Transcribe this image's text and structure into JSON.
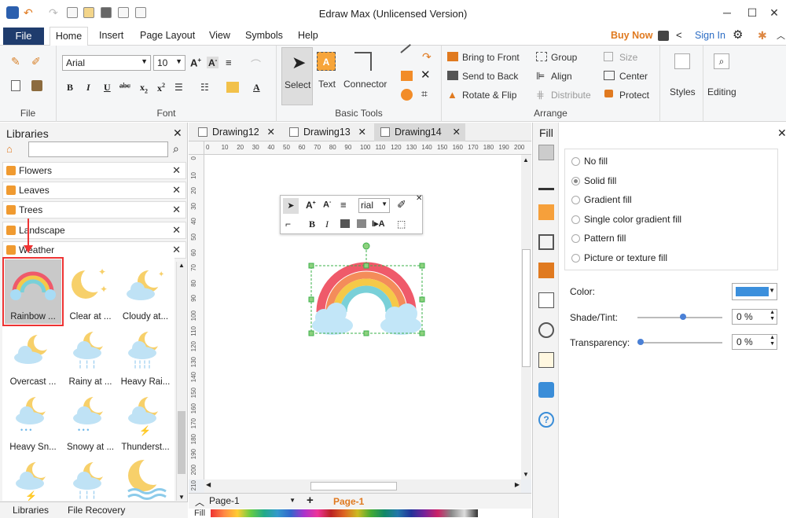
{
  "app": {
    "title": "Edraw Max (Unlicensed Version)"
  },
  "window_controls": {
    "minimize": "─",
    "maximize": "☐",
    "close": "✕"
  },
  "tabs": {
    "file": "File",
    "home": "Home",
    "insert": "Insert",
    "page_layout": "Page Layout",
    "view": "View",
    "symbols": "Symbols",
    "help": "Help"
  },
  "top_right": {
    "buy_now": "Buy Now",
    "sign_in": "Sign In"
  },
  "ribbon": {
    "file_group": "File",
    "font_group": "Font",
    "font_name": "Arial",
    "font_size": "10",
    "basic_tools": {
      "label": "Basic Tools",
      "select": "Select",
      "text": "Text",
      "connector": "Connector"
    },
    "arrange": {
      "label": "Arrange",
      "bring_to_front": "Bring to Front",
      "send_to_back": "Send to Back",
      "rotate_flip": "Rotate & Flip",
      "group": "Group",
      "align": "Align",
      "distribute": "Distribute",
      "size": "Size",
      "center": "Center",
      "protect": "Protect"
    },
    "styles": "Styles",
    "editing": "Editing"
  },
  "libraries": {
    "title": "Libraries",
    "categories": [
      "Flowers",
      "Leaves",
      "Trees",
      "Landscape",
      "Weather"
    ],
    "shapes": [
      "Rainbow ...",
      "Clear at ...",
      "Cloudy at...",
      "Overcast ...",
      "Rainy at ...",
      "Heavy Rai...",
      "Heavy Sn...",
      "Snowy at ...",
      "Thunderst..."
    ],
    "bottom_tabs": [
      "Libraries",
      "File Recovery"
    ]
  },
  "documents": {
    "tabs": [
      "Drawing12",
      "Drawing13",
      "Drawing14"
    ],
    "active": "Drawing14"
  },
  "rulers": {
    "h_ticks": [
      "0",
      "10",
      "20",
      "30",
      "40",
      "50",
      "60",
      "70",
      "80",
      "90",
      "100",
      "110",
      "120",
      "130",
      "140",
      "150",
      "160",
      "170",
      "180",
      "190",
      "200"
    ],
    "v_ticks": [
      "0",
      "10",
      "20",
      "30",
      "40",
      "50",
      "60",
      "70",
      "80",
      "90",
      "100",
      "110",
      "120",
      "130",
      "140",
      "150",
      "160",
      "170",
      "180",
      "190",
      "200",
      "210"
    ]
  },
  "mini_toolbar": {
    "font": "rial"
  },
  "pages": {
    "current": "Page-1",
    "tab": "Page-1"
  },
  "fill_label": "Fill",
  "fill_panel": {
    "title": "Fill",
    "options": [
      "No fill",
      "Solid fill",
      "Gradient fill",
      "Single color gradient fill",
      "Pattern fill",
      "Picture or texture fill"
    ],
    "selected": "Solid fill",
    "color_label": "Color:",
    "color_value": "#3b8fdc",
    "shade_label": "Shade/Tint:",
    "shade_value": "0 %",
    "shade_fraction": 0.5,
    "transparency_label": "Transparency:",
    "transparency_value": "0 %",
    "transparency_fraction": 0.0
  }
}
